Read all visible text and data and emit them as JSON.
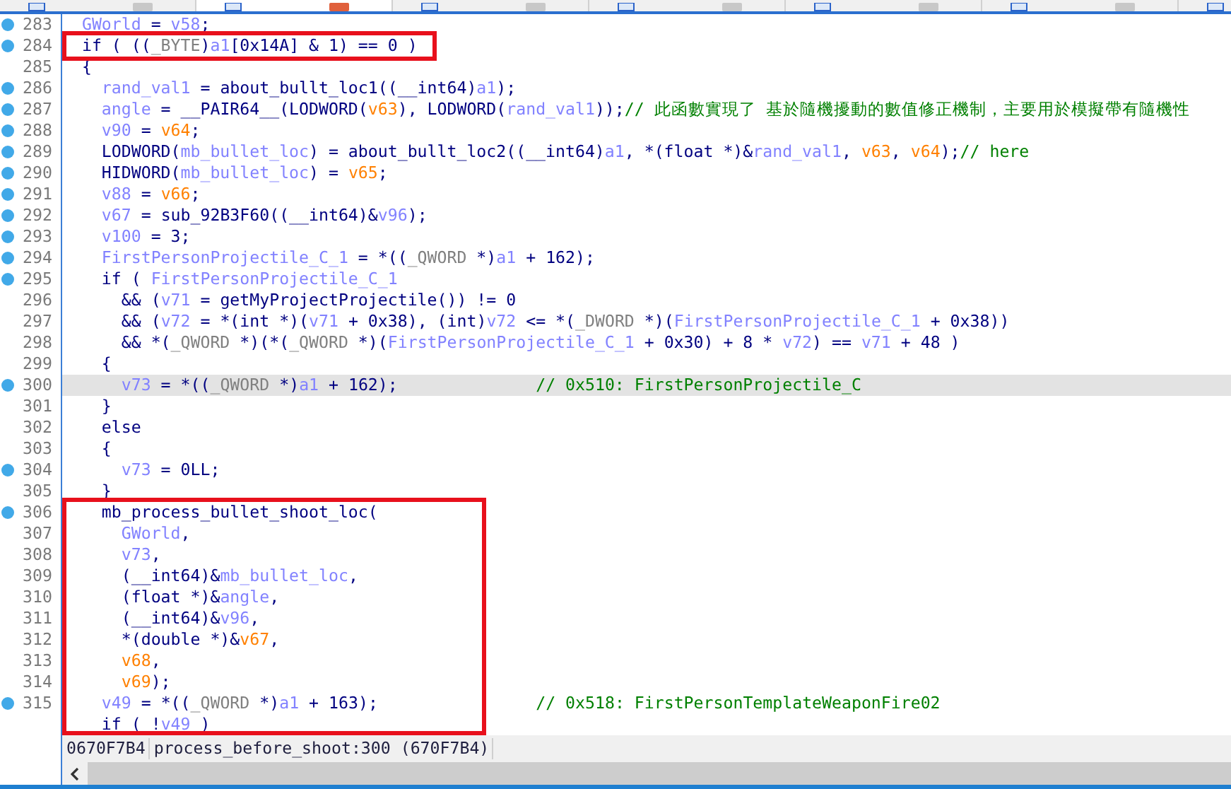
{
  "tabs": [
    {
      "selected": false
    },
    {
      "selected": true
    },
    {
      "selected": false
    },
    {
      "selected": false
    },
    {
      "selected": false
    },
    {
      "selected": false
    },
    {
      "selected": false
    }
  ],
  "blocks": [
    {
      "framed": false,
      "lines": [
        {
          "number": "283",
          "breakpoint": true,
          "current": false,
          "tokens": [
            {
              "kind": "var",
              "text": "  GWorld"
            },
            {
              "kind": "code",
              "text": " = "
            },
            {
              "kind": "var",
              "text": "v58"
            },
            {
              "kind": "code",
              "text": ";"
            }
          ]
        }
      ]
    },
    {
      "framed": true,
      "lines": [
        {
          "number": "284",
          "breakpoint": true,
          "current": false,
          "tokens": [
            {
              "kind": "code",
              "text": "  if ( (("
            },
            {
              "kind": "type",
              "text": "_BYTE"
            },
            {
              "kind": "code",
              "text": ")"
            },
            {
              "kind": "var",
              "text": "a1"
            },
            {
              "kind": "code",
              "text": "[0x14A] & 1) == 0 )"
            }
          ]
        }
      ]
    },
    {
      "framed": false,
      "lines": [
        {
          "number": "285",
          "breakpoint": false,
          "current": false,
          "tokens": [
            {
              "kind": "code",
              "text": "  {"
            }
          ]
        },
        {
          "number": "286",
          "breakpoint": true,
          "current": false,
          "tokens": [
            {
              "kind": "var",
              "text": "    rand_val1"
            },
            {
              "kind": "code",
              "text": " = about_bullt_loc1((__int64)"
            },
            {
              "kind": "var",
              "text": "a1"
            },
            {
              "kind": "code",
              "text": ");"
            }
          ]
        },
        {
          "number": "287",
          "breakpoint": true,
          "current": false,
          "tokens": [
            {
              "kind": "var",
              "text": "    angle"
            },
            {
              "kind": "code",
              "text": " = __PAIR64__(LODWORD("
            },
            {
              "kind": "local",
              "text": "v63"
            },
            {
              "kind": "code",
              "text": "), LODWORD("
            },
            {
              "kind": "var",
              "text": "rand_val1"
            },
            {
              "kind": "code",
              "text": "));"
            },
            {
              "kind": "comment",
              "text": "// 此函數實現了 基於隨機擾動的數值修正機制，主要用於模擬帶有隨機性"
            }
          ]
        },
        {
          "number": "288",
          "breakpoint": true,
          "current": false,
          "tokens": [
            {
              "kind": "var",
              "text": "    v90"
            },
            {
              "kind": "code",
              "text": " = "
            },
            {
              "kind": "local",
              "text": "v64"
            },
            {
              "kind": "code",
              "text": ";"
            }
          ]
        },
        {
          "number": "289",
          "breakpoint": true,
          "current": false,
          "tokens": [
            {
              "kind": "code",
              "text": "    LODWORD("
            },
            {
              "kind": "var",
              "text": "mb_bullet_loc"
            },
            {
              "kind": "code",
              "text": ") = about_bullt_loc2((__int64)"
            },
            {
              "kind": "var",
              "text": "a1"
            },
            {
              "kind": "code",
              "text": ", *(float *)&"
            },
            {
              "kind": "var",
              "text": "rand_val1"
            },
            {
              "kind": "code",
              "text": ", "
            },
            {
              "kind": "local",
              "text": "v63"
            },
            {
              "kind": "code",
              "text": ", "
            },
            {
              "kind": "local",
              "text": "v64"
            },
            {
              "kind": "code",
              "text": ");"
            },
            {
              "kind": "comment",
              "text": "// here"
            }
          ]
        },
        {
          "number": "290",
          "breakpoint": true,
          "current": false,
          "tokens": [
            {
              "kind": "code",
              "text": "    HIDWORD("
            },
            {
              "kind": "var",
              "text": "mb_bullet_loc"
            },
            {
              "kind": "code",
              "text": ") = "
            },
            {
              "kind": "local",
              "text": "v65"
            },
            {
              "kind": "code",
              "text": ";"
            }
          ]
        },
        {
          "number": "291",
          "breakpoint": true,
          "current": false,
          "tokens": [
            {
              "kind": "var",
              "text": "    v88"
            },
            {
              "kind": "code",
              "text": " = "
            },
            {
              "kind": "local",
              "text": "v66"
            },
            {
              "kind": "code",
              "text": ";"
            }
          ]
        },
        {
          "number": "292",
          "breakpoint": true,
          "current": false,
          "tokens": [
            {
              "kind": "var",
              "text": "    v67"
            },
            {
              "kind": "code",
              "text": " = sub_92B3F60((__int64)&"
            },
            {
              "kind": "var",
              "text": "v96"
            },
            {
              "kind": "code",
              "text": ");"
            }
          ]
        },
        {
          "number": "293",
          "breakpoint": true,
          "current": false,
          "tokens": [
            {
              "kind": "var",
              "text": "    v100"
            },
            {
              "kind": "code",
              "text": " = 3;"
            }
          ]
        },
        {
          "number": "294",
          "breakpoint": true,
          "current": false,
          "tokens": [
            {
              "kind": "var",
              "text": "    FirstPersonProjectile_C_1"
            },
            {
              "kind": "code",
              "text": " = *(("
            },
            {
              "kind": "type",
              "text": "_QWORD"
            },
            {
              "kind": "code",
              "text": " *)"
            },
            {
              "kind": "var",
              "text": "a1"
            },
            {
              "kind": "code",
              "text": " + 162);"
            }
          ]
        },
        {
          "number": "295",
          "breakpoint": true,
          "current": false,
          "tokens": [
            {
              "kind": "code",
              "text": "    if ( "
            },
            {
              "kind": "var",
              "text": "FirstPersonProjectile_C_1"
            }
          ]
        },
        {
          "number": "296",
          "breakpoint": false,
          "current": false,
          "tokens": [
            {
              "kind": "code",
              "text": "      && ("
            },
            {
              "kind": "var",
              "text": "v71"
            },
            {
              "kind": "code",
              "text": " = getMyProjectProjectile()) != 0"
            }
          ]
        },
        {
          "number": "297",
          "breakpoint": false,
          "current": false,
          "tokens": [
            {
              "kind": "code",
              "text": "      && ("
            },
            {
              "kind": "var",
              "text": "v72"
            },
            {
              "kind": "code",
              "text": " = *(int *)("
            },
            {
              "kind": "var",
              "text": "v71"
            },
            {
              "kind": "code",
              "text": " + 0x38), (int)"
            },
            {
              "kind": "var",
              "text": "v72"
            },
            {
              "kind": "code",
              "text": " <= *("
            },
            {
              "kind": "type",
              "text": "_DWORD"
            },
            {
              "kind": "code",
              "text": " *)("
            },
            {
              "kind": "var",
              "text": "FirstPersonProjectile_C_1"
            },
            {
              "kind": "code",
              "text": " + 0x38))"
            }
          ]
        },
        {
          "number": "298",
          "breakpoint": false,
          "current": false,
          "tokens": [
            {
              "kind": "code",
              "text": "      && *("
            },
            {
              "kind": "type",
              "text": "_QWORD"
            },
            {
              "kind": "code",
              "text": " *)(*("
            },
            {
              "kind": "type",
              "text": "_QWORD"
            },
            {
              "kind": "code",
              "text": " *)("
            },
            {
              "kind": "var",
              "text": "FirstPersonProjectile_C_1"
            },
            {
              "kind": "code",
              "text": " + 0x30) + 8 * "
            },
            {
              "kind": "var",
              "text": "v72"
            },
            {
              "kind": "code",
              "text": ") == "
            },
            {
              "kind": "var",
              "text": "v71"
            },
            {
              "kind": "code",
              "text": " + 48 )"
            }
          ]
        },
        {
          "number": "299",
          "breakpoint": false,
          "current": false,
          "tokens": [
            {
              "kind": "code",
              "text": "    {"
            }
          ]
        },
        {
          "number": "300",
          "breakpoint": true,
          "current": true,
          "tokens": [
            {
              "kind": "var",
              "text": "      v73"
            },
            {
              "kind": "code",
              "text": " = *(("
            },
            {
              "kind": "type",
              "text": "_QWORD"
            },
            {
              "kind": "code",
              "text": " *)"
            },
            {
              "kind": "var",
              "text": "a1"
            },
            {
              "kind": "code",
              "text": " + 162);              "
            },
            {
              "kind": "comment",
              "text": "// 0x510: FirstPersonProjectile_C"
            }
          ]
        },
        {
          "number": "301",
          "breakpoint": false,
          "current": false,
          "tokens": [
            {
              "kind": "code",
              "text": "    }"
            }
          ]
        },
        {
          "number": "302",
          "breakpoint": false,
          "current": false,
          "tokens": [
            {
              "kind": "code",
              "text": "    else"
            }
          ]
        },
        {
          "number": "303",
          "breakpoint": false,
          "current": false,
          "tokens": [
            {
              "kind": "code",
              "text": "    {"
            }
          ]
        },
        {
          "number": "304",
          "breakpoint": true,
          "current": false,
          "tokens": [
            {
              "kind": "var",
              "text": "      v73"
            },
            {
              "kind": "code",
              "text": " = 0LL;"
            }
          ]
        },
        {
          "number": "305",
          "breakpoint": false,
          "current": false,
          "tokens": [
            {
              "kind": "code",
              "text": "    }"
            }
          ]
        }
      ]
    },
    {
      "framed": true,
      "lines": [
        {
          "number": "306",
          "breakpoint": true,
          "current": false,
          "tokens": [
            {
              "kind": "code",
              "text": "    mb_process_bullet_shoot_loc("
            }
          ]
        },
        {
          "number": "307",
          "breakpoint": false,
          "current": false,
          "tokens": [
            {
              "kind": "var",
              "text": "      GWorld"
            },
            {
              "kind": "code",
              "text": ","
            }
          ]
        },
        {
          "number": "308",
          "breakpoint": false,
          "current": false,
          "tokens": [
            {
              "kind": "var",
              "text": "      v73"
            },
            {
              "kind": "code",
              "text": ","
            }
          ]
        },
        {
          "number": "309",
          "breakpoint": false,
          "current": false,
          "tokens": [
            {
              "kind": "code",
              "text": "      (__int64)&"
            },
            {
              "kind": "var",
              "text": "mb_bullet_loc"
            },
            {
              "kind": "code",
              "text": ","
            }
          ]
        },
        {
          "number": "310",
          "breakpoint": false,
          "current": false,
          "tokens": [
            {
              "kind": "code",
              "text": "      (float *)&"
            },
            {
              "kind": "var",
              "text": "angle"
            },
            {
              "kind": "code",
              "text": ","
            }
          ]
        },
        {
          "number": "311",
          "breakpoint": false,
          "current": false,
          "tokens": [
            {
              "kind": "code",
              "text": "      (__int64)&"
            },
            {
              "kind": "var",
              "text": "v96"
            },
            {
              "kind": "code",
              "text": ","
            }
          ]
        },
        {
          "number": "312",
          "breakpoint": false,
          "current": false,
          "tokens": [
            {
              "kind": "code",
              "text": "      *(double *)&"
            },
            {
              "kind": "local",
              "text": "v67"
            },
            {
              "kind": "code",
              "text": ","
            }
          ]
        },
        {
          "number": "313",
          "breakpoint": false,
          "current": false,
          "tokens": [
            {
              "kind": "local",
              "text": "      v68"
            },
            {
              "kind": "code",
              "text": ","
            }
          ]
        },
        {
          "number": "314",
          "breakpoint": false,
          "current": false,
          "tokens": [
            {
              "kind": "local",
              "text": "      v69"
            },
            {
              "kind": "code",
              "text": ");"
            }
          ]
        },
        {
          "number": "315",
          "breakpoint": true,
          "current": false,
          "tokens": [
            {
              "kind": "var",
              "text": "    v49"
            },
            {
              "kind": "code",
              "text": " = *(("
            },
            {
              "kind": "type",
              "text": "_QWORD"
            },
            {
              "kind": "code",
              "text": " *)"
            },
            {
              "kind": "var",
              "text": "a1"
            },
            {
              "kind": "code",
              "text": " + 163);                "
            },
            {
              "kind": "comment",
              "text": "// 0x518: FirstPersonTemplateWeaponFire02"
            }
          ]
        },
        {
          "breakpoint": false,
          "current": false,
          "tokens": [
            {
              "kind": "code",
              "text": "    if ( !"
            },
            {
              "kind": "var",
              "text": "v49"
            },
            {
              "kind": "code",
              "text": " )"
            }
          ]
        }
      ]
    }
  ],
  "status_bar": {
    "address": "0670F7B4",
    "location": "process_before_shoot:300 (670F7B4)"
  }
}
